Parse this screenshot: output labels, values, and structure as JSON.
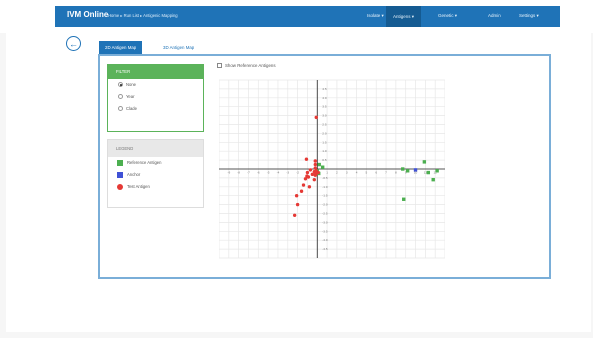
{
  "app": {
    "brand": "IVM Online",
    "breadcrumb": "Home ▸ Run List ▸ Antigenic Mapping",
    "nav": [
      {
        "label": "Isolate ▾"
      },
      {
        "label": "Antigens ▾",
        "active": true
      },
      {
        "label": "Genetic ▾"
      },
      {
        "label": "Admin"
      },
      {
        "label": "Settings ▾"
      }
    ]
  },
  "tabs": [
    "2D Antigen Map",
    "3D Antigen Map"
  ],
  "filter": {
    "title": "FILTER",
    "options": [
      "None",
      "Year",
      "Clade"
    ],
    "selected": "None"
  },
  "legend": {
    "title": "LEGEND",
    "items": [
      {
        "label": "Reference Antigen",
        "color": "#4caf50"
      },
      {
        "label": "Anchor",
        "color": "#3f51d6"
      },
      {
        "label": "Test Antigen",
        "color": "#e53935"
      }
    ]
  },
  "toggle_reference": "Show Reference Antigens",
  "chart_data": {
    "type": "scatter",
    "x_range": [
      -10,
      13
    ],
    "y_range": [
      -5,
      5
    ],
    "x_ticks": [
      "-9",
      "-8",
      "-7",
      "-6",
      "-5",
      "-4",
      "-3",
      "-2",
      "-1",
      "1",
      "2",
      "3",
      "4",
      "5",
      "6",
      "7",
      "8",
      "9",
      "10",
      "11",
      "12"
    ],
    "y_ticks": [
      "4.5",
      "4.0",
      "3.5",
      "3.0",
      "2.5",
      "2.0",
      "1.5",
      "1.0",
      "0.5",
      "-0.5",
      "-1.0",
      "-1.5",
      "-2.0",
      "-2.5",
      "-3.0",
      "-3.5",
      "-4.0",
      "-4.5"
    ],
    "series": [
      {
        "name": "Reference Antigen",
        "color": "#4caf50",
        "points": [
          [
            0.2,
            0.25
          ],
          [
            0.15,
            -0.25
          ],
          [
            0.55,
            0.1
          ],
          [
            0.0,
            -0.1
          ],
          [
            8.7,
            0.0
          ],
          [
            9.2,
            -0.1
          ],
          [
            10.9,
            0.4
          ],
          [
            11.3,
            -0.2
          ],
          [
            12.2,
            -0.1
          ],
          [
            11.8,
            -0.6
          ],
          [
            8.8,
            -1.7
          ]
        ]
      },
      {
        "name": "Anchor",
        "color": "#3f51d6",
        "points": [
          [
            10.0,
            -0.05
          ]
        ]
      },
      {
        "name": "Test Antigen",
        "color": "#e53935",
        "points": [
          [
            -0.1,
            2.9
          ],
          [
            -1.1,
            0.55
          ],
          [
            -0.2,
            0.45
          ],
          [
            -0.2,
            0.25
          ],
          [
            -0.2,
            0.05
          ],
          [
            -0.1,
            -0.1
          ],
          [
            -0.3,
            -0.15
          ],
          [
            -0.1,
            -0.25
          ],
          [
            -0.2,
            -0.35
          ],
          [
            -0.7,
            -0.05
          ],
          [
            -1.0,
            -0.2
          ],
          [
            -1.05,
            -0.4
          ],
          [
            -1.2,
            -0.55
          ],
          [
            -0.9,
            -0.45
          ],
          [
            -0.5,
            -0.3
          ],
          [
            -1.4,
            -0.9
          ],
          [
            -0.8,
            -1.0
          ],
          [
            -1.6,
            -1.25
          ],
          [
            -2.1,
            -1.5
          ],
          [
            -2.0,
            -2.0
          ],
          [
            -2.3,
            -2.6
          ],
          [
            -0.3,
            -0.6
          ],
          [
            -0.2,
            -0.2
          ],
          [
            0.1,
            -0.2
          ]
        ]
      }
    ]
  }
}
